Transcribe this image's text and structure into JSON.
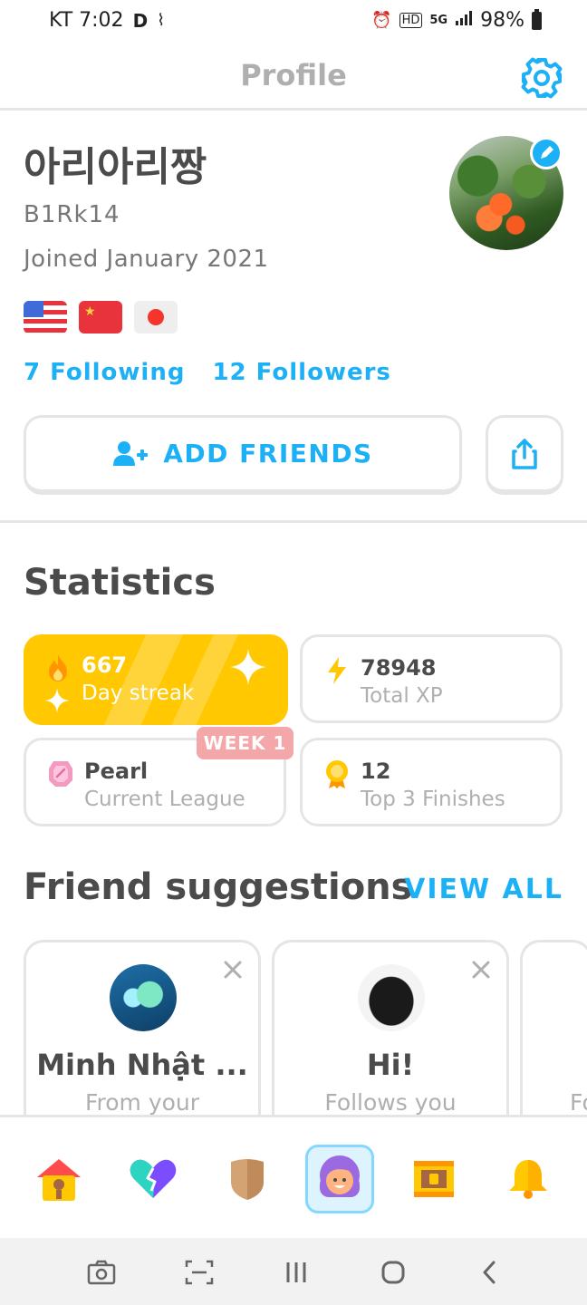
{
  "status_bar": {
    "carrier_time": "KT 7:02",
    "app_glyph": "D",
    "battery_percent": "98%"
  },
  "header": {
    "title": "Profile",
    "settings_icon": "gear-icon"
  },
  "profile": {
    "display_name": "아리아리짱",
    "username": "B1Rk14",
    "joined": "Joined January 2021",
    "flags": [
      "us-flag",
      "china-flag",
      "japan-flag"
    ],
    "following": "7 Following",
    "followers": "12 Followers",
    "add_friends_label": "ADD FRIENDS"
  },
  "statistics": {
    "title": "Statistics",
    "cards": [
      {
        "value": "667",
        "label": "Day streak",
        "icon": "flame-icon"
      },
      {
        "value": "78948",
        "label": "Total XP",
        "icon": "lightning-icon"
      },
      {
        "value": "Pearl",
        "label": "Current League",
        "icon": "pearl-gem-icon",
        "badge": "WEEK 1"
      },
      {
        "value": "12",
        "label": "Top 3 Finishes",
        "icon": "medal-icon"
      }
    ]
  },
  "friend_suggestions": {
    "title": "Friend suggestions",
    "view_all": "VIEW ALL",
    "items": [
      {
        "name": "Minh Nhật ...",
        "reason": "From your"
      },
      {
        "name": "Hi!",
        "reason": "Follows you"
      },
      {
        "name": "",
        "reason": "Fo"
      }
    ]
  },
  "bottom_nav": [
    "home-icon",
    "hearts-icon",
    "league-shield-icon",
    "profile-icon",
    "chest-icon",
    "bell-icon"
  ],
  "colors": {
    "accent_blue": "#1cb0f6",
    "streak_yellow": "#ffc800",
    "border_gray": "#e5e5e5",
    "muted_text": "#afafaf",
    "week_badge": "#f4a7a9"
  }
}
